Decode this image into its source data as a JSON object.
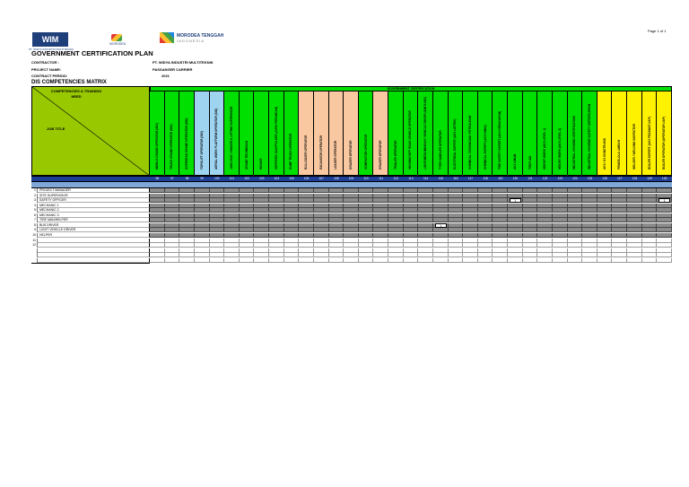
{
  "page_number": "Page 1 of 1",
  "logos": {
    "wim_text": "WIM",
    "wim_subtext": "PT. WIDYA INDUSTRI MULTITEKNIK",
    "middle_text": "MORODEA",
    "right_text": "MORODEA TENGGAH",
    "right_subtext": "INDONESIA"
  },
  "title": "GOVERNMENT CERTIFICATION PLAN",
  "meta": {
    "contractor_label": "CONTRACTOR :",
    "contractor_value": "PT. WIDYA INDUSTRI MULTITEKNIK",
    "project_label": "PROJECT NAME:",
    "project_value": "PASSANGER CARRIER",
    "period_label": "CONTRACT PERIOD:",
    "period_value": "2021"
  },
  "matrix_title": "DIS COMPETENCIES MATRIX",
  "competencies_heading": "COMPETENCIES & TRAINING NEED",
  "job_title_heading": "JOB TITLE",
  "gov_cert_heading": "GOVERNMENT CERTIFICATION",
  "columns": [
    {
      "label": "MOBILE CRANE OPERATOR (SIO)",
      "num": "96",
      "color": "#00e000"
    },
    {
      "label": "TRUCK CRANE OPERATOR (SIO)",
      "num": "97",
      "color": "#00e000"
    },
    {
      "label": "OVERHEAD CRANE OPERATOR (SIO)",
      "num": "98",
      "color": "#00e000"
    },
    {
      "label": "FORKLIFT OPERATOR (SIO)",
      "num": "99",
      "color": "#9fd4f0"
    },
    {
      "label": "AERIAL WORK PLATFORM OPERATOR (SIO)",
      "num": "100",
      "color": "#9fd4f0"
    },
    {
      "label": "JURU IKAT / RIGGER & LIFTING SUPERVISOR",
      "num": "101",
      "color": "#00e000"
    },
    {
      "label": "CRANE TECHNICIAN",
      "num": "102",
      "color": "#00e000"
    },
    {
      "label": "RIGGER",
      "num": "103",
      "color": "#00e000"
    },
    {
      "label": "CERTIFIED SCAFFOLDER (JURU PERANCAH)",
      "num": "104",
      "color": "#00e000"
    },
    {
      "label": "DUMP TRUCK OPERATOR",
      "num": "105",
      "color": "#00e000"
    },
    {
      "label": "BULLDOZER OPERATOR",
      "num": "106",
      "color": "#f9c8a0"
    },
    {
      "label": "EXCAVATOR OPERATOR",
      "num": "107",
      "color": "#f9c8a0"
    },
    {
      "label": "LOADER OPERATOR",
      "num": "108",
      "color": "#f9c8a0"
    },
    {
      "label": "GRADER OPERATOR",
      "num": "109",
      "color": "#f9c8a0"
    },
    {
      "label": "COMPACTOR OPERATOR",
      "num": "110",
      "color": "#00e000"
    },
    {
      "label": "GRADER OPERATOR",
      "num": "111",
      "color": "#f9c8a0"
    },
    {
      "label": "TRAILER OPERATOR",
      "num": "112",
      "color": "#00e000"
    },
    {
      "label": "HIGHWAY/OFF ROAD VEHICLE OPERATOR",
      "num": "113",
      "color": "#00e000"
    },
    {
      "label": "LIGHT/MEDIUM/HEAVY VEHICLE DRIVER (SIM B1/B2)",
      "num": "114",
      "color": "#00e000"
    },
    {
      "label": "TYRE HANDLER OPERATOR",
      "num": "115",
      "color": "#00e000"
    },
    {
      "label": "ELECTRICAL EXPERT (AK3 LISTRIK)",
      "num": "116",
      "color": "#00e000"
    },
    {
      "label": "CHEMICAL TECHNICIAN / PETROLEUM",
      "num": "117",
      "color": "#00e000"
    },
    {
      "label": "CHEMICAL EXPERT (AK3 KIMIA)",
      "num": "118",
      "color": "#00e000"
    },
    {
      "label": "FIRE SAFETY EXPERT (AK3 KEBAKARAN)",
      "num": "119",
      "color": "#00e000"
    },
    {
      "label": "AK3 UMUM",
      "num": "120",
      "color": "#00e000"
    },
    {
      "label": "FIRST AID",
      "num": "121",
      "color": "#00e000"
    },
    {
      "label": "HEIGHT WORK (AK3 LEVEL 1)",
      "num": "122",
      "color": "#00e000"
    },
    {
      "label": "HEIGHT WORK (AK3 LEVEL 2)",
      "num": "123",
      "color": "#00e000"
    },
    {
      "label": "INDUSTRIAL HYGIENE CERTIFICATION",
      "num": "124",
      "color": "#00e000"
    },
    {
      "label": "INDUSTRIAL HYGIENE SAFETY CERTIFICATION",
      "num": "125",
      "color": "#00e000"
    },
    {
      "label": "AK3 / K3 KONSTRUKSI",
      "num": "126",
      "color": "#fff200"
    },
    {
      "label": "PENGELOLA LIMBAH",
      "num": "127",
      "color": "#fff200"
    },
    {
      "label": "WELDER / WELDING INSPECTOR",
      "num": "128",
      "color": "#fff200"
    },
    {
      "label": "BOILER EXPERT (AK3 PESAWAT UAP)",
      "num": "129",
      "color": "#fff200"
    },
    {
      "label": "BOILER OPERATOR (OPERATOR UAP)",
      "num": "130",
      "color": "#fff200"
    }
  ],
  "rows": [
    {
      "no": "1",
      "title": "PROJECT MANAGER"
    },
    {
      "no": "2",
      "title": "SITE SUPERVISOR"
    },
    {
      "no": "3",
      "title": "SAFETY OFFICER"
    },
    {
      "no": "4",
      "title": "MECHANIC 1"
    },
    {
      "no": "5",
      "title": "MECHANIC 2"
    },
    {
      "no": "6",
      "title": "MECHANIC 3"
    },
    {
      "no": "7",
      "title": "TIRE MAN/HELPER"
    },
    {
      "no": "8",
      "title": "BUS DRIVER"
    },
    {
      "no": "9",
      "title": "LIGHT VEHICLE DRIVER"
    },
    {
      "no": "10",
      "title": "HELPER"
    },
    {
      "no": "11",
      "title": ""
    },
    {
      "no": "12",
      "title": ""
    },
    {
      "no": "",
      "title": ""
    },
    {
      "no": "",
      "title": ""
    },
    {
      "no": "",
      "title": ""
    }
  ],
  "marks": [
    {
      "row": 2,
      "col": 24,
      "value": "1"
    },
    {
      "row": 2,
      "col": 34,
      "value": "1"
    },
    {
      "row": 7,
      "col": 19,
      "value": "1"
    }
  ]
}
